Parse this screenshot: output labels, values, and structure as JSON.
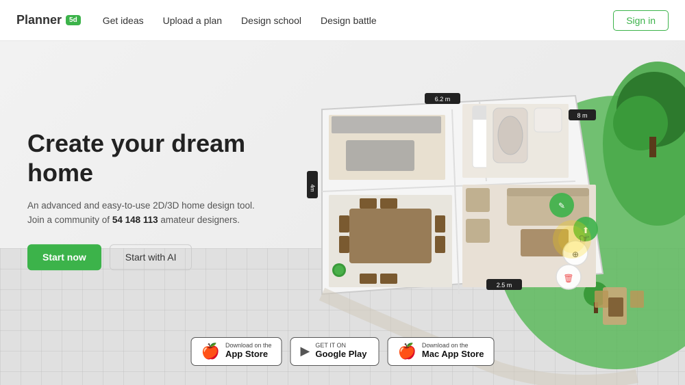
{
  "brand": {
    "name": "Planner",
    "badge": "5d"
  },
  "nav": {
    "links": [
      {
        "id": "get-ideas",
        "label": "Get ideas"
      },
      {
        "id": "upload-plan",
        "label": "Upload a plan"
      },
      {
        "id": "design-school",
        "label": "Design school"
      },
      {
        "id": "design-battle",
        "label": "Design battle"
      }
    ],
    "signin": "Sign in"
  },
  "hero": {
    "title": "Create your dream home",
    "description_pre": "An advanced and easy-to-use 2D/3D home design tool.",
    "description_community": "Join a community of",
    "community_count": "54 148 113",
    "description_post": "amateur designers.",
    "btn_start": "Start now",
    "btn_ai": "Start with AI"
  },
  "app_stores": [
    {
      "id": "app-store",
      "small": "Download on the",
      "big": "App Store",
      "icon": "🍎"
    },
    {
      "id": "google-play",
      "small": "GET IT ON",
      "big": "Google Play",
      "icon": "▶"
    },
    {
      "id": "mac-app-store",
      "small": "Download on the",
      "big": "Mac App Store",
      "icon": "🍎"
    }
  ]
}
